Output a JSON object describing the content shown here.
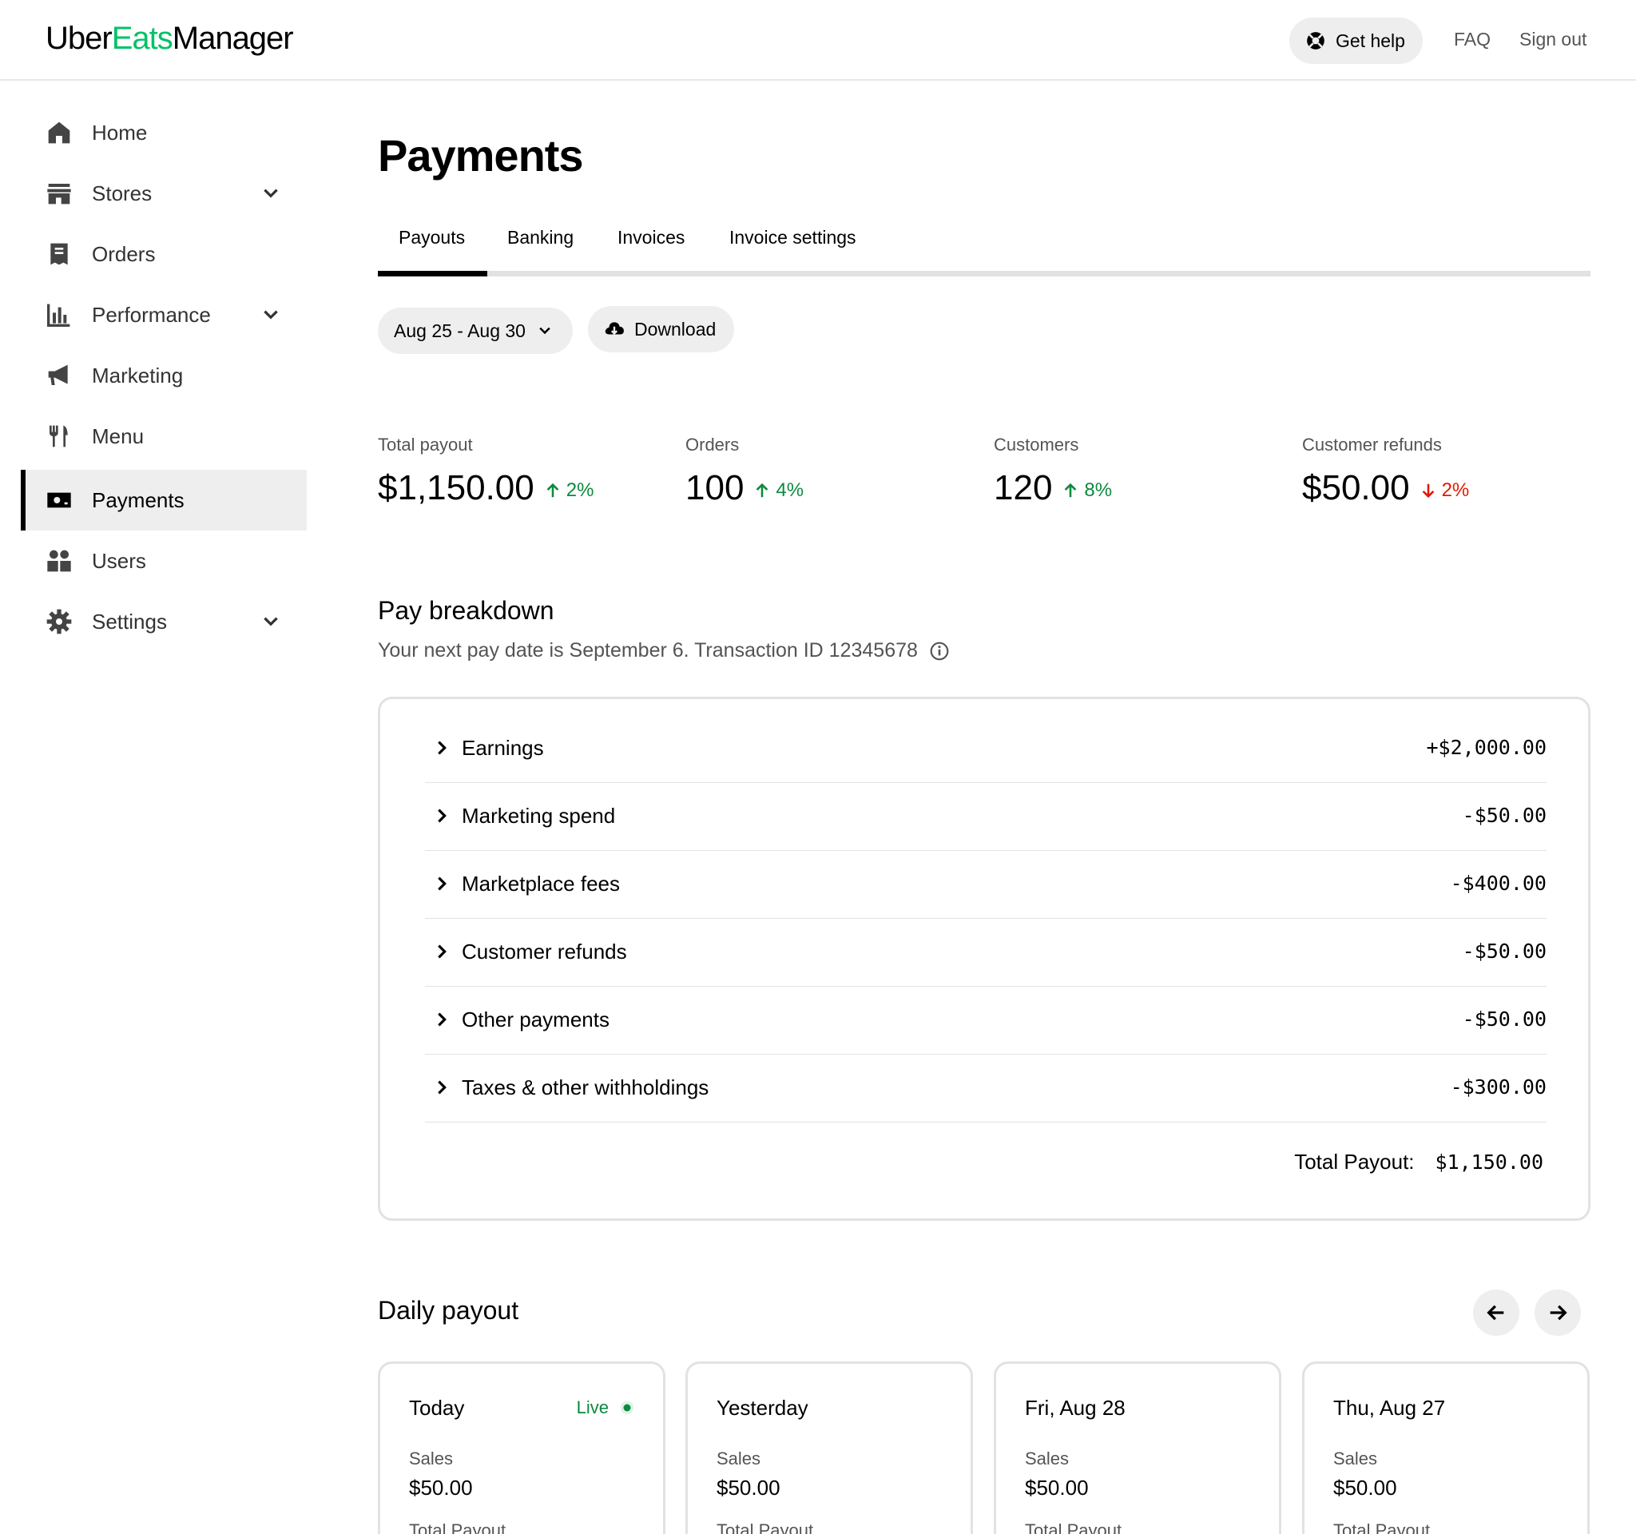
{
  "header": {
    "logo": {
      "part1": "Uber",
      "part2": "Eats",
      "part3": "Manager"
    },
    "help_label": "Get help",
    "faq_label": "FAQ",
    "signout_label": "Sign out"
  },
  "sidebar": {
    "items": [
      {
        "label": "Home",
        "icon": "home-icon"
      },
      {
        "label": "Stores",
        "icon": "store-icon",
        "expandable": true
      },
      {
        "label": "Orders",
        "icon": "receipt-icon"
      },
      {
        "label": "Performance",
        "icon": "bar-chart-icon",
        "expandable": true
      },
      {
        "label": "Marketing",
        "icon": "megaphone-icon"
      },
      {
        "label": "Menu",
        "icon": "utensils-icon"
      },
      {
        "label": "Payments",
        "icon": "money-icon",
        "active": true
      },
      {
        "label": "Users",
        "icon": "users-icon"
      },
      {
        "label": "Settings",
        "icon": "gear-icon",
        "expandable": true
      }
    ]
  },
  "page": {
    "title": "Payments",
    "tabs": [
      "Payouts",
      "Banking",
      "Invoices",
      "Invoice settings"
    ],
    "active_tab": "Payouts",
    "date_range": "Aug 25 - Aug 30",
    "download_label": "Download"
  },
  "stats": [
    {
      "label": "Total payout",
      "value": "$1,150.00",
      "delta": "2%",
      "direction": "up"
    },
    {
      "label": "Orders",
      "value": "100",
      "delta": "4%",
      "direction": "up"
    },
    {
      "label": "Customers",
      "value": "120",
      "delta": "8%",
      "direction": "up"
    },
    {
      "label": "Customer refunds",
      "value": "$50.00",
      "delta": "2%",
      "direction": "down"
    }
  ],
  "pay_breakdown": {
    "title": "Pay breakdown",
    "subtitle": "Your next pay date is September 6. Transaction ID 12345678",
    "rows": [
      {
        "label": "Earnings",
        "value": "+$2,000.00"
      },
      {
        "label": "Marketing spend",
        "value": "-$50.00"
      },
      {
        "label": "Marketplace fees",
        "value": "-$400.00"
      },
      {
        "label": "Customer refunds",
        "value": "-$50.00"
      },
      {
        "label": "Other payments",
        "value": "-$50.00"
      },
      {
        "label": "Taxes & other withholdings",
        "value": "-$300.00"
      }
    ],
    "total_label": "Total Payout:",
    "total_value": "$1,150.00"
  },
  "daily_payout": {
    "title": "Daily payout",
    "cards": [
      {
        "title": "Today",
        "live_label": "Live",
        "sales_label": "Sales",
        "sales_value": "$50.00",
        "total_label": "Total Payout"
      },
      {
        "title": "Yesterday",
        "sales_label": "Sales",
        "sales_value": "$50.00",
        "total_label": "Total Payout"
      },
      {
        "title": "Fri, Aug 28",
        "sales_label": "Sales",
        "sales_value": "$50.00",
        "total_label": "Total Payout"
      },
      {
        "title": "Thu, Aug 27",
        "sales_label": "Sales",
        "sales_value": "$50.00",
        "total_label": "Total Payout"
      }
    ]
  },
  "colors": {
    "brand_green": "#06c167",
    "delta_up": "#0b8a3e",
    "delta_down": "#e11900",
    "pill_bg": "#eeeeee",
    "border": "#e2e2e2"
  }
}
